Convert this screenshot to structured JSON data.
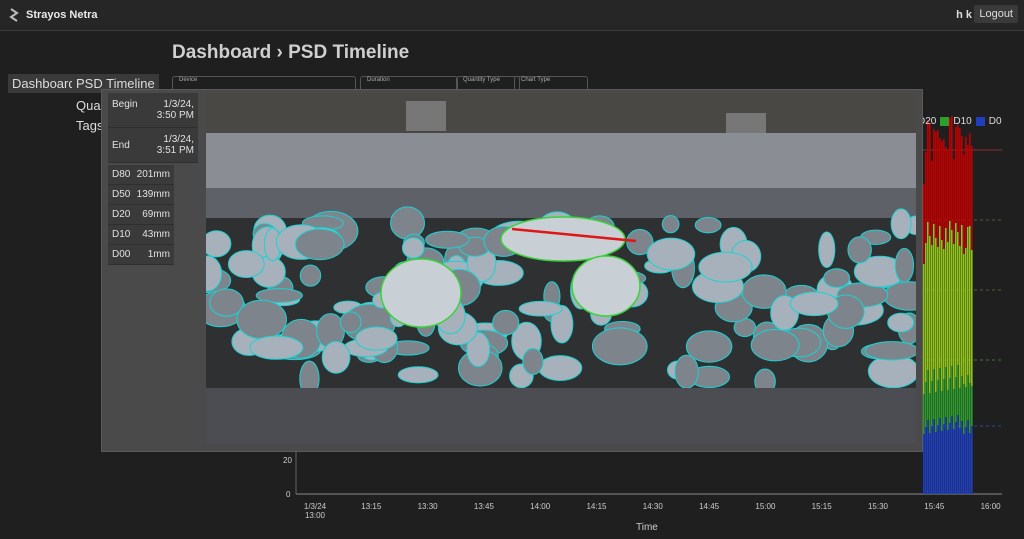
{
  "app": {
    "name": "Strayos Netra",
    "user": "h k",
    "logout_label": "Logout"
  },
  "page": {
    "title": "Dashboard › PSD Timeline"
  },
  "nav": {
    "items": [
      {
        "label": "Dashboard"
      },
      {
        "label": "PSD Timeline"
      },
      {
        "label": "Quar"
      },
      {
        "label": "Tags"
      }
    ]
  },
  "filters": [
    "Device",
    "Duration",
    "Quantity Type",
    "Chart Type"
  ],
  "modal": {
    "begin_label": "Begin",
    "begin_value_1": "1/3/24,",
    "begin_value_2": "3:50 PM",
    "end_label": "End",
    "end_value_1": "1/3/24,",
    "end_value_2": "3:51 PM",
    "stats": [
      {
        "label": "D80",
        "value": "201mm"
      },
      {
        "label": "D50",
        "value": "139mm"
      },
      {
        "label": "D20",
        "value": "69mm"
      },
      {
        "label": "D10",
        "value": "43mm"
      },
      {
        "label": "D00",
        "value": "1mm"
      }
    ]
  },
  "chart_data": {
    "type": "bar",
    "xlabel": "Time",
    "x_ticks": [
      "1/3/24 13:00",
      "13:15",
      "13:30",
      "13:45",
      "14:00",
      "14:15",
      "14:30",
      "14:45",
      "15:00",
      "15:15",
      "15:30",
      "15:45",
      "16:00"
    ],
    "y_ticks": [
      0,
      20
    ],
    "legend": [
      {
        "name": "D20",
        "color": "#c00000"
      },
      {
        "name": "D10",
        "color": "#2ca02c"
      },
      {
        "name": "D0",
        "color": "#1f3fbf"
      }
    ],
    "colors": {
      "D80": "#c00000",
      "D50": "#8fc21b",
      "D20": "#2e9a2e",
      "D10": "#1f3fbf"
    }
  }
}
